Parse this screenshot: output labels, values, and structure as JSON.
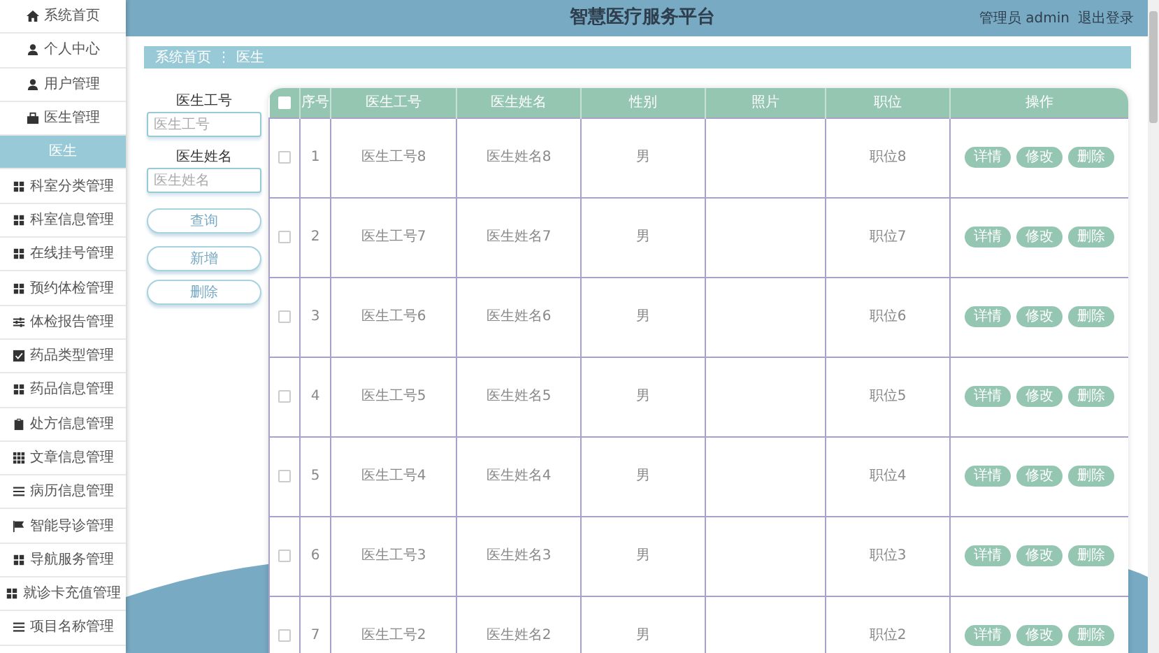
{
  "sidebar": {
    "items": [
      {
        "label": "系统首页",
        "selected": false
      },
      {
        "label": "个人中心",
        "selected": false
      },
      {
        "label": "用户管理",
        "selected": false
      },
      {
        "label": "医生管理",
        "selected": false
      },
      {
        "label": "医生",
        "selected": true
      },
      {
        "label": "科室分类管理",
        "selected": false
      },
      {
        "label": "科室信息管理",
        "selected": false
      },
      {
        "label": "在线挂号管理",
        "selected": false
      },
      {
        "label": "预约体检管理",
        "selected": false
      },
      {
        "label": "体检报告管理",
        "selected": false
      },
      {
        "label": "药品类型管理",
        "selected": false
      },
      {
        "label": "药品信息管理",
        "selected": false
      },
      {
        "label": "处方信息管理",
        "selected": false
      },
      {
        "label": "文章信息管理",
        "selected": false
      },
      {
        "label": "病历信息管理",
        "selected": false
      },
      {
        "label": "智能导诊管理",
        "selected": false
      },
      {
        "label": "导航服务管理",
        "selected": false
      },
      {
        "label": "就诊卡充值管理",
        "selected": false
      },
      {
        "label": "项目名称管理",
        "selected": false
      }
    ]
  },
  "header": {
    "title": "智慧医疗服务平台",
    "user": "管理员 admin",
    "logout": "退出登录"
  },
  "breadcrumb": [
    "系统首页",
    "医生"
  ],
  "breadcrumb_separator": "⋮",
  "search": {
    "fields": [
      {
        "label": "医生工号",
        "placeholder": "医生工号"
      },
      {
        "label": "医生姓名",
        "placeholder": "医生姓名"
      }
    ],
    "buttons": [
      "查询",
      "新增",
      "删除"
    ]
  },
  "table": {
    "select_all_checked": false,
    "columns": [
      "序号",
      "医生工号",
      "医生姓名",
      "性别",
      "照片",
      "职位",
      "操作"
    ],
    "rows": [
      {
        "checked": false,
        "cells": [
          "1",
          "医生工号8",
          "医生姓名8",
          "男",
          "",
          "职位8"
        ],
        "actions": [
          "详情",
          "修改",
          "删除"
        ]
      },
      {
        "checked": false,
        "cells": [
          "2",
          "医生工号7",
          "医生姓名7",
          "男",
          "",
          "职位7"
        ],
        "actions": [
          "详情",
          "修改",
          "删除"
        ]
      },
      {
        "checked": false,
        "cells": [
          "3",
          "医生工号6",
          "医生姓名6",
          "男",
          "",
          "职位6"
        ],
        "actions": [
          "详情",
          "修改",
          "删除"
        ]
      },
      {
        "checked": false,
        "cells": [
          "4",
          "医生工号5",
          "医生姓名5",
          "男",
          "",
          "职位5"
        ],
        "actions": [
          "详情",
          "修改",
          "删除"
        ]
      },
      {
        "checked": false,
        "cells": [
          "5",
          "医生工号4",
          "医生姓名4",
          "男",
          "",
          "职位4"
        ],
        "actions": [
          "详情",
          "修改",
          "删除"
        ]
      },
      {
        "checked": false,
        "cells": [
          "6",
          "医生工号3",
          "医生姓名3",
          "男",
          "",
          "职位3"
        ],
        "actions": [
          "详情",
          "修改",
          "删除"
        ]
      },
      {
        "checked": false,
        "cells": [
          "7",
          "医生工号2",
          "医生姓名2",
          "男",
          "",
          "职位2"
        ],
        "actions": [
          "详情",
          "修改",
          "删除"
        ]
      }
    ]
  }
}
